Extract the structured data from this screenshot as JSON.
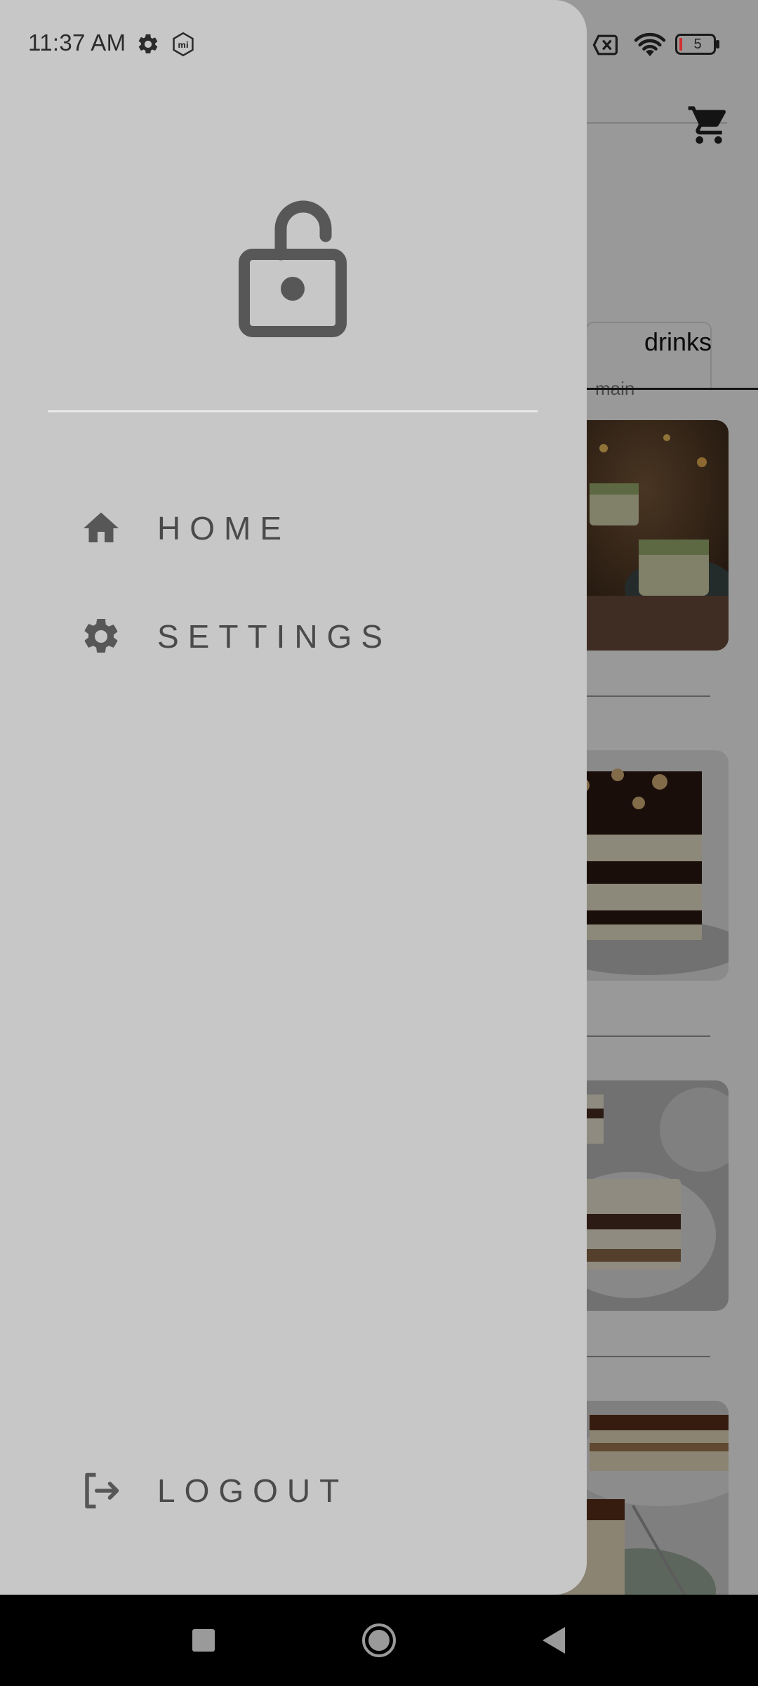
{
  "status_bar": {
    "time": "11:37 AM",
    "battery_level": "5",
    "icons": [
      "gear-icon",
      "mi-icon",
      "sim-off-icon",
      "wifi-icon",
      "battery-icon"
    ]
  },
  "background": {
    "category_tab": "drinks",
    "category_sub": "main",
    "cart_icon": "cart-icon"
  },
  "drawer": {
    "header_icon": "lock-open-icon",
    "menu": [
      {
        "label": "HOME",
        "icon": "home-icon"
      },
      {
        "label": "SETTINGS",
        "icon": "settings-icon"
      }
    ],
    "footer": {
      "label": "LOGOUT",
      "icon": "logout-icon"
    }
  },
  "nav_bar": {
    "buttons": [
      "recents-button",
      "home-button",
      "back-button"
    ]
  },
  "colors": {
    "drawer_bg": "#c7c7c7",
    "icon_color": "#575757",
    "label_color": "#4a4a4a",
    "scrim": "rgba(0,0,0,0.40)",
    "nav_bg": "#000000"
  }
}
